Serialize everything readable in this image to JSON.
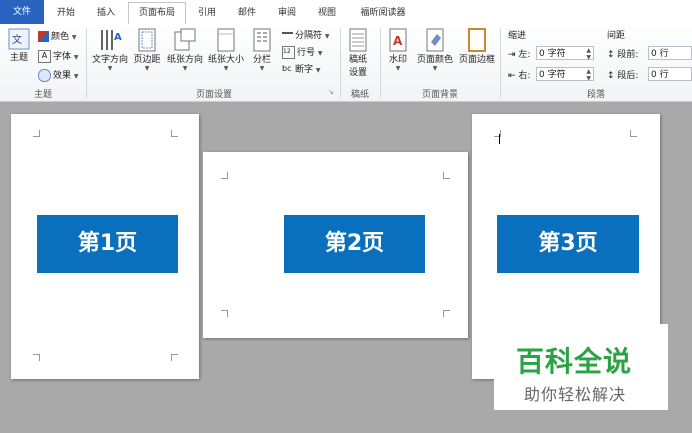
{
  "tabs": {
    "file": "文件",
    "home": "开始",
    "insert": "插入",
    "layout": "页面布局",
    "references": "引用",
    "mailings": "邮件",
    "review": "审阅",
    "view": "视图",
    "foxit": "福昕阅读器"
  },
  "theme_group": {
    "themes": "主题",
    "colors": "颜色",
    "fonts": "字体",
    "effects": "效果",
    "label": "主题"
  },
  "page_setup": {
    "text_direction": "文字方向",
    "margins": "页边距",
    "orientation": "纸张方向",
    "size": "纸张大小",
    "columns": "分栏",
    "breaks": "分隔符",
    "line_numbers": "行号",
    "hyphenation": "断字",
    "label": "页面设置"
  },
  "manuscript": {
    "settings_line1": "稿纸",
    "settings_line2": "设置",
    "label": "稿纸"
  },
  "page_background": {
    "watermark": "水印",
    "page_color": "页面颜色",
    "page_borders": "页面边框",
    "label": "页面背景"
  },
  "paragraph": {
    "indent": "缩进",
    "spacing": "间距",
    "left_label": "左:",
    "left_value": "0 字符",
    "right_label": "右:",
    "right_value": "0 字符",
    "before_label": "段前:",
    "before_value": "0 行",
    "after_label": "段后:",
    "after_value": "0 行",
    "label": "段落"
  },
  "pages": [
    "第1页",
    "第2页",
    "第3页"
  ],
  "watermark": {
    "title": "百科全说",
    "subtitle": "助你轻松解决"
  },
  "colors": {
    "file_tab": "#2b63c0",
    "banner": "#0a6fbc",
    "watermark_green": "#2aa344"
  }
}
